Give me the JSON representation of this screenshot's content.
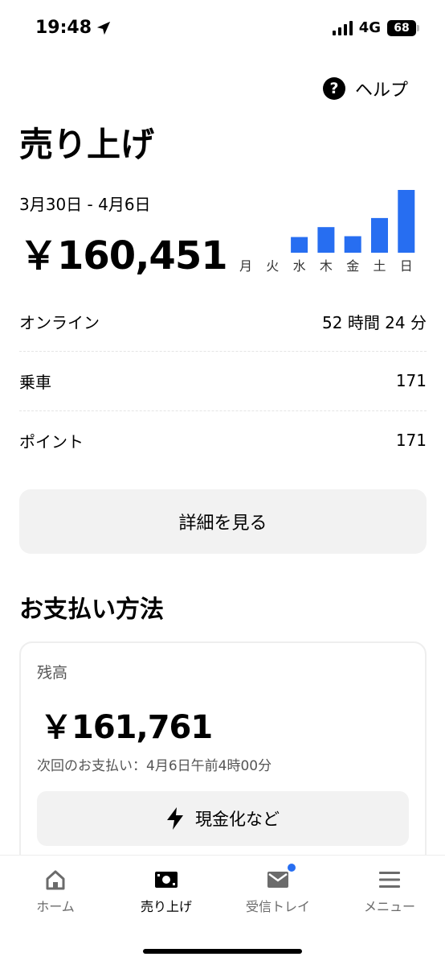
{
  "status": {
    "time": "19:48",
    "network": "4G",
    "battery": "68"
  },
  "header": {
    "help_label": "ヘルプ",
    "title": "売り上げ"
  },
  "summary": {
    "date_range": "3月30日 - 4月6日",
    "total": "￥160,451"
  },
  "chart_data": {
    "type": "bar",
    "categories": [
      "月",
      "火",
      "水",
      "木",
      "金",
      "土",
      "日"
    ],
    "values": [
      0,
      0,
      19,
      31,
      20,
      42,
      76
    ],
    "color": "#276ef1"
  },
  "stats": [
    {
      "label": "オンライン",
      "value": "52 時間 24 分"
    },
    {
      "label": "乗車",
      "value": "171"
    },
    {
      "label": "ポイント",
      "value": "171"
    }
  ],
  "details_button": "詳細を見る",
  "payment": {
    "section_title": "お支払い方法",
    "card_label": "残高",
    "balance": "￥161,761",
    "next_payment": "次回のお支払い：4月6日午前4時00分",
    "cash_button": "現金化など"
  },
  "tabs": [
    {
      "label": "ホーム",
      "icon": "home-icon",
      "active": false
    },
    {
      "label": "売り上げ",
      "icon": "earnings-icon",
      "active": true
    },
    {
      "label": "受信トレイ",
      "icon": "inbox-icon",
      "active": false
    },
    {
      "label": "メニュー",
      "icon": "menu-icon",
      "active": false
    }
  ],
  "colors": {
    "accent": "#276ef1",
    "button_bg": "#f2f2f2"
  }
}
